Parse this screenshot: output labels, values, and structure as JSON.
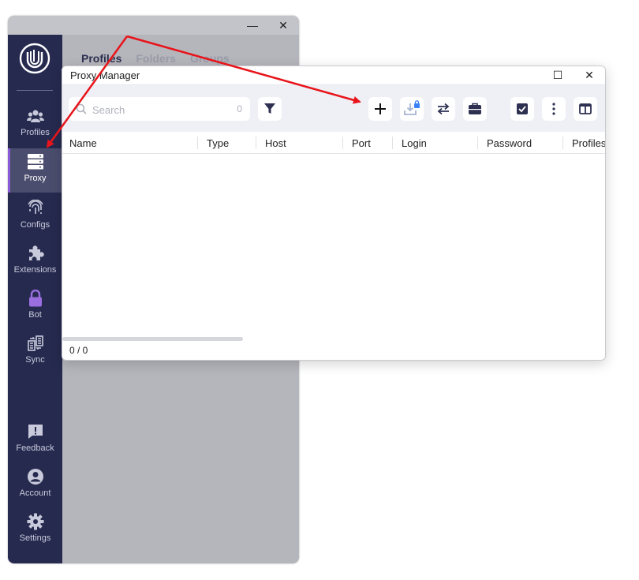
{
  "main_window": {
    "controls": {
      "minimize": "—",
      "close": "✕"
    },
    "sidebar": {
      "items": [
        {
          "label": "Profiles",
          "icon": "users-icon"
        },
        {
          "label": "Proxy",
          "icon": "server-icon",
          "active": true
        },
        {
          "label": "Configs",
          "icon": "fingerprint-icon"
        },
        {
          "label": "Extensions",
          "icon": "puzzle-icon"
        },
        {
          "label": "Bot",
          "icon": "lock-icon"
        },
        {
          "label": "Sync",
          "icon": "sync-icon"
        },
        {
          "label": "Feedback",
          "icon": "feedback-icon"
        },
        {
          "label": "Account",
          "icon": "account-icon"
        },
        {
          "label": "Settings",
          "icon": "gear-icon"
        }
      ]
    },
    "tabs": [
      "Profiles",
      "Folders",
      "Groups"
    ]
  },
  "proxy_manager": {
    "title": "Proxy Manager",
    "controls": {
      "maximize": "☐",
      "close": "✕"
    },
    "search": {
      "placeholder": "Search",
      "count": "0"
    },
    "columns": [
      "Name",
      "Type",
      "Host",
      "Port",
      "Login",
      "Password",
      "Profiles"
    ],
    "footer": "0 / 0"
  },
  "colors": {
    "sidebar_bg": "#262a4f",
    "accent_purple": "#8a5bd6",
    "annotation_arrow": "#e8141a"
  }
}
